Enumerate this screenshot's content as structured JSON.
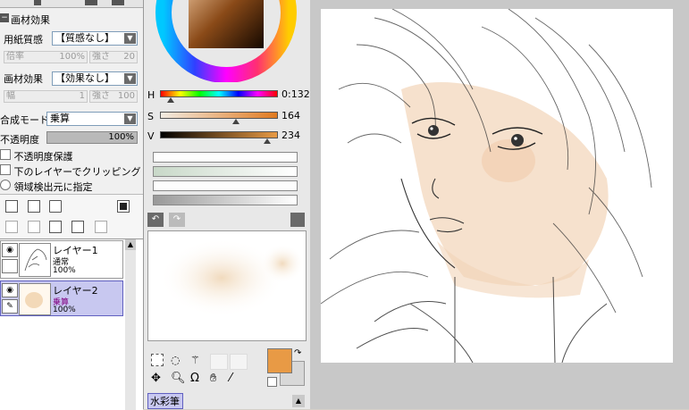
{
  "left_panel": {
    "texture_section": "画材効果",
    "paper_texture_label": "用紙質感",
    "paper_texture_value": "【質感なし】",
    "ratio_label": "倍率",
    "ratio_value": "100%",
    "strength_label": "強さ",
    "strength_value": "20",
    "effect_label": "画材効果",
    "effect_value": "【効果なし】",
    "width_label": "幅",
    "width_value": "1",
    "effect_strength_label": "強さ",
    "effect_strength_value": "100",
    "blend_mode_label": "合成モード",
    "blend_mode_value": "乗算",
    "opacity_label": "不透明度",
    "opacity_value": "100%",
    "preserve_opacity": "不透明度保護",
    "clip_below": "下のレイヤーでクリッピング",
    "selection_source": "領域検出元に指定",
    "layers": [
      {
        "name": "レイヤー1",
        "mode": "通常",
        "opacity": "100%"
      },
      {
        "name": "レイヤー2",
        "mode": "乗算",
        "opacity": "100%"
      }
    ]
  },
  "color_panel": {
    "h_label": "H",
    "h_value": "0:132",
    "s_label": "S",
    "s_value": "164",
    "v_label": "V",
    "v_value": "234",
    "tool_name": "水彩筆",
    "fg_color": "#e89a45",
    "bg_color": "#d8d8d8"
  }
}
